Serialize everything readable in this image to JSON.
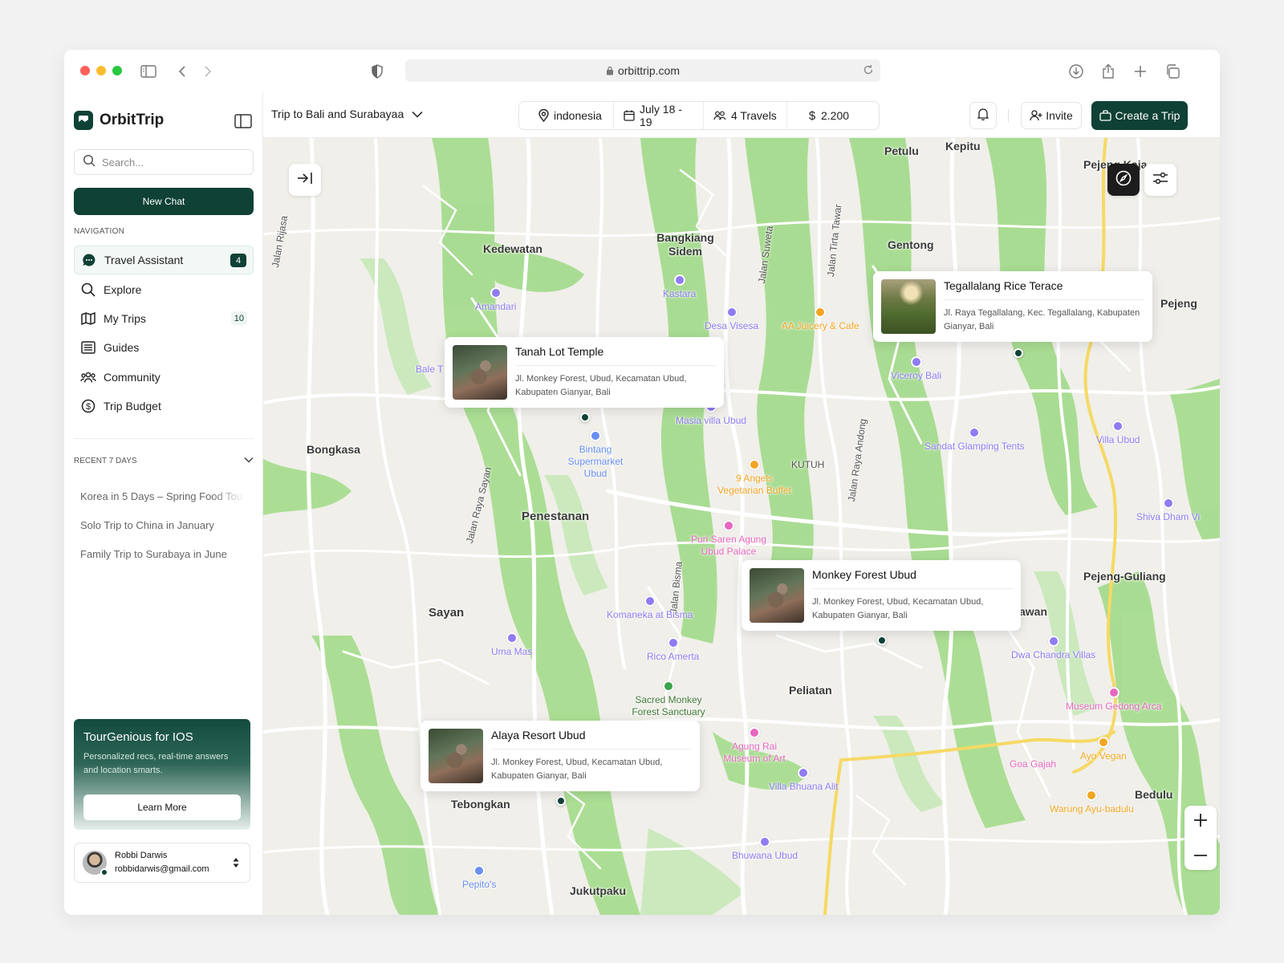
{
  "browser": {
    "url": "orbittrip.com",
    "traffic_lights": [
      "#ff5f57",
      "#febc2e",
      "#28c840"
    ]
  },
  "colors": {
    "brand": "#0f4135",
    "poi_purple": "#8f7cf2",
    "poi_pink": "#e767c0",
    "poi_orange": "#f2a524",
    "poi_green": "#3ba34a",
    "park_green": "#9fd98a"
  },
  "sidebar": {
    "brand": "OrbitTrip",
    "search_placeholder": "Search...",
    "new_chat": "New Chat",
    "nav_label": "NAVIGATION",
    "nav": [
      {
        "label": "Travel Assistant",
        "icon": "chat-icon",
        "badge": "4"
      },
      {
        "label": "Explore",
        "icon": "search-icon",
        "badge": ""
      },
      {
        "label": "My Trips",
        "icon": "map-icon",
        "badge": "10"
      },
      {
        "label": "Guides",
        "icon": "guide-icon",
        "badge": ""
      },
      {
        "label": "Community",
        "icon": "community-icon",
        "badge": ""
      },
      {
        "label": "Trip Budget",
        "icon": "dollar-icon",
        "badge": ""
      }
    ],
    "recent_label": "RECENT 7 DAYS",
    "recent": [
      "Korea in 5 Days – Spring Food Tou",
      "Solo Trip to China in January",
      "Family Trip to Surabaya in June"
    ],
    "promo": {
      "title": "TourGenious for IOS",
      "text": "Personalized recs, real-time answers and location smarts.",
      "button": "Learn More"
    },
    "user": {
      "name": "Robbi Darwis",
      "email": "robbidarwis@gmail.com"
    }
  },
  "topbar": {
    "trip_title": "Trip to Bali and Surabayaa",
    "location": "indonesia",
    "dates": "July 18 - 19",
    "travelers": "4 Travels",
    "budget": "2.200",
    "invite": "Invite",
    "create": "Create a Trip"
  },
  "map": {
    "towns": [
      "Kedewatan",
      "Bangkiang Sidem",
      "Gentong",
      "Petulu",
      "Kepitu",
      "Pejeng Kaja",
      "Pejeng",
      "Bongkasa",
      "Penestanan",
      "KUTUH",
      "Sayan",
      "Pejeng-Guliang",
      "Peliatan",
      "Tebongkan",
      "Jukutpaku",
      "Bedulu",
      "awan",
      "Bale T"
    ],
    "roads": [
      "Jalan Rijasa",
      "Jalan Suweta",
      "Jalan Tirta Tawar",
      "Jalan Raya Andong",
      "Jalan Raya Sayan",
      "Jalan Bisma"
    ],
    "pois": [
      {
        "name": "Amandari",
        "type": "purple"
      },
      {
        "name": "Kastara",
        "type": "purple"
      },
      {
        "name": "Desa Visesa",
        "type": "purple"
      },
      {
        "name": "AA Juicery & Cafe",
        "type": "orange"
      },
      {
        "name": "Viceroy Bali",
        "type": "purple"
      },
      {
        "name": "Masia villa Ubud",
        "type": "purple"
      },
      {
        "name": "Bintang Supermarket Ubud",
        "type": "blue"
      },
      {
        "name": "9 Angels Vegetarian Buffet",
        "type": "orange"
      },
      {
        "name": "Sandat Glamping Tents",
        "type": "purple"
      },
      {
        "name": "Villa Ubud",
        "type": "purple"
      },
      {
        "name": "Shiva Dham Vi",
        "type": "purple"
      },
      {
        "name": "Puri Saren Agung Ubud Palace",
        "type": "pink"
      },
      {
        "name": "Komaneka at Bisma",
        "type": "purple"
      },
      {
        "name": "Uma Mas",
        "type": "purple"
      },
      {
        "name": "Rico Amerta",
        "type": "purple"
      },
      {
        "name": "Sacred Monkey Forest Sanctuary",
        "type": "green"
      },
      {
        "name": "Dwa Chandra Villas",
        "type": "purple"
      },
      {
        "name": "Museum Gedong Arca",
        "type": "pink"
      },
      {
        "name": "Agung Rai Museum of Art",
        "type": "pink"
      },
      {
        "name": "Villa Bhuana Alit",
        "type": "purple"
      },
      {
        "name": "Goa Gajah",
        "type": "pink"
      },
      {
        "name": "Ayo Vegan",
        "type": "orange"
      },
      {
        "name": "Warung Ayu-badulu",
        "type": "orange"
      },
      {
        "name": "Bhuwana Ubud",
        "type": "purple"
      },
      {
        "name": "Pepito's",
        "type": "blue"
      }
    ],
    "cards": [
      {
        "title": "Tegallalang Rice Terace",
        "address": "Jl. Raya Tegallalang, Kec. Tegallalang, Kabupaten Gianyar, Bali",
        "thumb": "rice"
      },
      {
        "title": "Tanah Lot Temple",
        "address": "Jl. Monkey Forest, Ubud, Kecamatan Ubud, Kabupaten Gianyar, Bali",
        "thumb": "monkey"
      },
      {
        "title": "Monkey Forest Ubud",
        "address": "Jl. Monkey Forest, Ubud, Kecamatan Ubud, Kabupaten Gianyar, Bali",
        "thumb": "monkey"
      },
      {
        "title": "Alaya Resort Ubud",
        "address": "Jl. Monkey Forest, Ubud, Kecamatan Ubud, Kabupaten Gianyar, Bali",
        "thumb": "monkey"
      }
    ]
  }
}
